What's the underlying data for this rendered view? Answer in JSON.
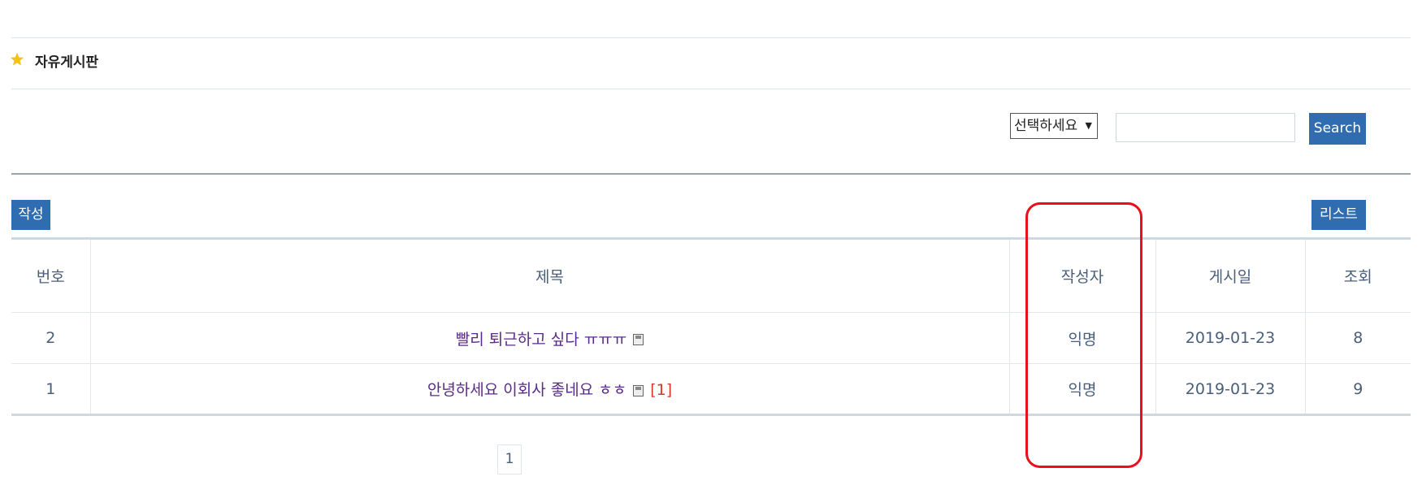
{
  "board": {
    "title": "자유게시판"
  },
  "search": {
    "select_value": "선택하세요",
    "input_value": "",
    "button_label": "Search"
  },
  "buttons": {
    "write": "작성",
    "list": "리스트"
  },
  "table": {
    "headers": [
      "번호",
      "제목",
      "작성자",
      "게시일",
      "조회"
    ],
    "rows": [
      {
        "no": "2",
        "title": "빨리 퇴근하고 싶다 ㅠㅠㅠ",
        "comments": "",
        "author": "익명",
        "date": "2019-01-23",
        "views": "8"
      },
      {
        "no": "1",
        "title": "안녕하세요 이회사 좋네요 ㅎㅎ",
        "comments": "[1]",
        "author": "익명",
        "date": "2019-01-23",
        "views": "9"
      }
    ]
  },
  "pagination": {
    "current": "1"
  },
  "colors": {
    "button": "#2f6db0",
    "highlight": "#e8101c",
    "star": "#f2c21a",
    "title_link": "#5a2a8a"
  },
  "icons": {
    "title": "star-icon",
    "attachment": "file-icon",
    "select_arrow": "dropdown-arrow-icon"
  }
}
